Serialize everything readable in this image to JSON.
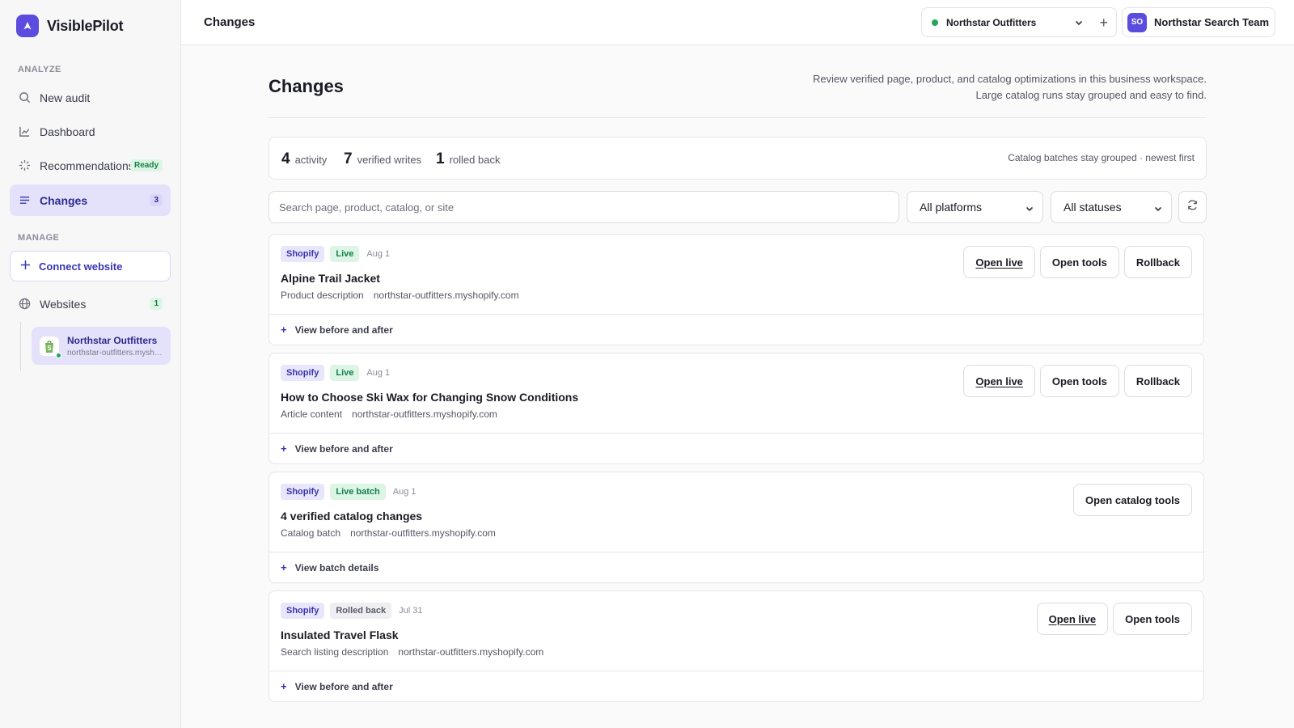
{
  "app": {
    "name_plain": "Visible",
    "name_bold": "Pilot"
  },
  "sidebar": {
    "analyze_label": "ANALYZE",
    "manage_label": "MANAGE",
    "nav": [
      {
        "label": "New audit",
        "icon": "search-icon"
      },
      {
        "label": "Dashboard",
        "icon": "chart-icon"
      },
      {
        "label": "Recommendations",
        "icon": "sparkle-icon",
        "badge": "Ready"
      },
      {
        "label": "Changes",
        "icon": "list-icon",
        "badge": "3",
        "active": true
      }
    ],
    "connect_label": "Connect website",
    "websites_label": "Websites",
    "websites_count": "1",
    "site": {
      "name": "Northstar Outfitters",
      "url": "northstar-outfitters.myshopify.com"
    }
  },
  "topbar": {
    "title": "Changes",
    "workspace": "Northstar Outfitters",
    "team_initials": "SO",
    "team_name": "Northstar Search Team"
  },
  "page": {
    "title": "Changes",
    "desc_line1": "Review verified page, product, and catalog optimizations in this business workspace.",
    "desc_line2": "Large catalog runs stay grouped and easy to find."
  },
  "stats": {
    "activity_num": "4",
    "activity_label": "activity",
    "writes_num": "7",
    "writes_label": "verified writes",
    "rolled_num": "1",
    "rolled_label": "rolled back",
    "note": "Catalog batches stay grouped · newest first"
  },
  "filters": {
    "search_placeholder": "Search page, product, catalog, or site",
    "platform": "All platforms",
    "status": "All statuses"
  },
  "changes": [
    {
      "platform": "Shopify",
      "status": "Live",
      "date": "Aug 1",
      "title": "Alpine Trail Jacket",
      "type": "Product description",
      "site": "northstar-outfitters.myshopify.com",
      "actions": [
        "Open live",
        "Open tools",
        "Rollback"
      ],
      "footer": "View before and after"
    },
    {
      "platform": "Shopify",
      "status": "Live",
      "date": "Aug 1",
      "title": "How to Choose Ski Wax for Changing Snow Conditions",
      "type": "Article content",
      "site": "northstar-outfitters.myshopify.com",
      "actions": [
        "Open live",
        "Open tools",
        "Rollback"
      ],
      "footer": "View before and after"
    },
    {
      "platform": "Shopify",
      "status": "Live batch",
      "date": "Aug 1",
      "title": "4 verified catalog changes",
      "type": "Catalog batch",
      "site": "northstar-outfitters.myshopify.com",
      "actions": [
        "Open catalog tools"
      ],
      "footer": "View batch details"
    },
    {
      "platform": "Shopify",
      "status": "Rolled back",
      "date": "Jul 31",
      "title": "Insulated Travel Flask",
      "type": "Search listing description",
      "site": "northstar-outfitters.myshopify.com",
      "actions": [
        "Open live",
        "Open tools"
      ],
      "footer": "View before and after"
    }
  ],
  "colors": {
    "accent": "#5b4ce0",
    "live": "#14804a",
    "live_bg": "#dcf5e5"
  }
}
